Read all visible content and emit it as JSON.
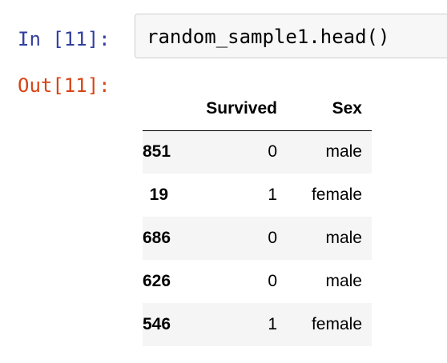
{
  "cell": {
    "input_prompt": "In [11]:",
    "input_code": "random_sample1.head()",
    "output_prompt": "Out[11]:"
  },
  "dataframe": {
    "index_header": "",
    "columns": [
      "Survived",
      "Sex"
    ],
    "rows": [
      {
        "index": "851",
        "values": [
          "0",
          "male"
        ]
      },
      {
        "index": "19",
        "values": [
          "1",
          "female"
        ]
      },
      {
        "index": "686",
        "values": [
          "0",
          "male"
        ]
      },
      {
        "index": "626",
        "values": [
          "0",
          "male"
        ]
      },
      {
        "index": "546",
        "values": [
          "1",
          "female"
        ]
      }
    ]
  },
  "colors": {
    "input_prompt": "#303f9f",
    "output_prompt": "#d84315",
    "input_background": "#f7f7f7",
    "input_border": "#cfcfcf",
    "striped_row": "#f5f5f5"
  }
}
